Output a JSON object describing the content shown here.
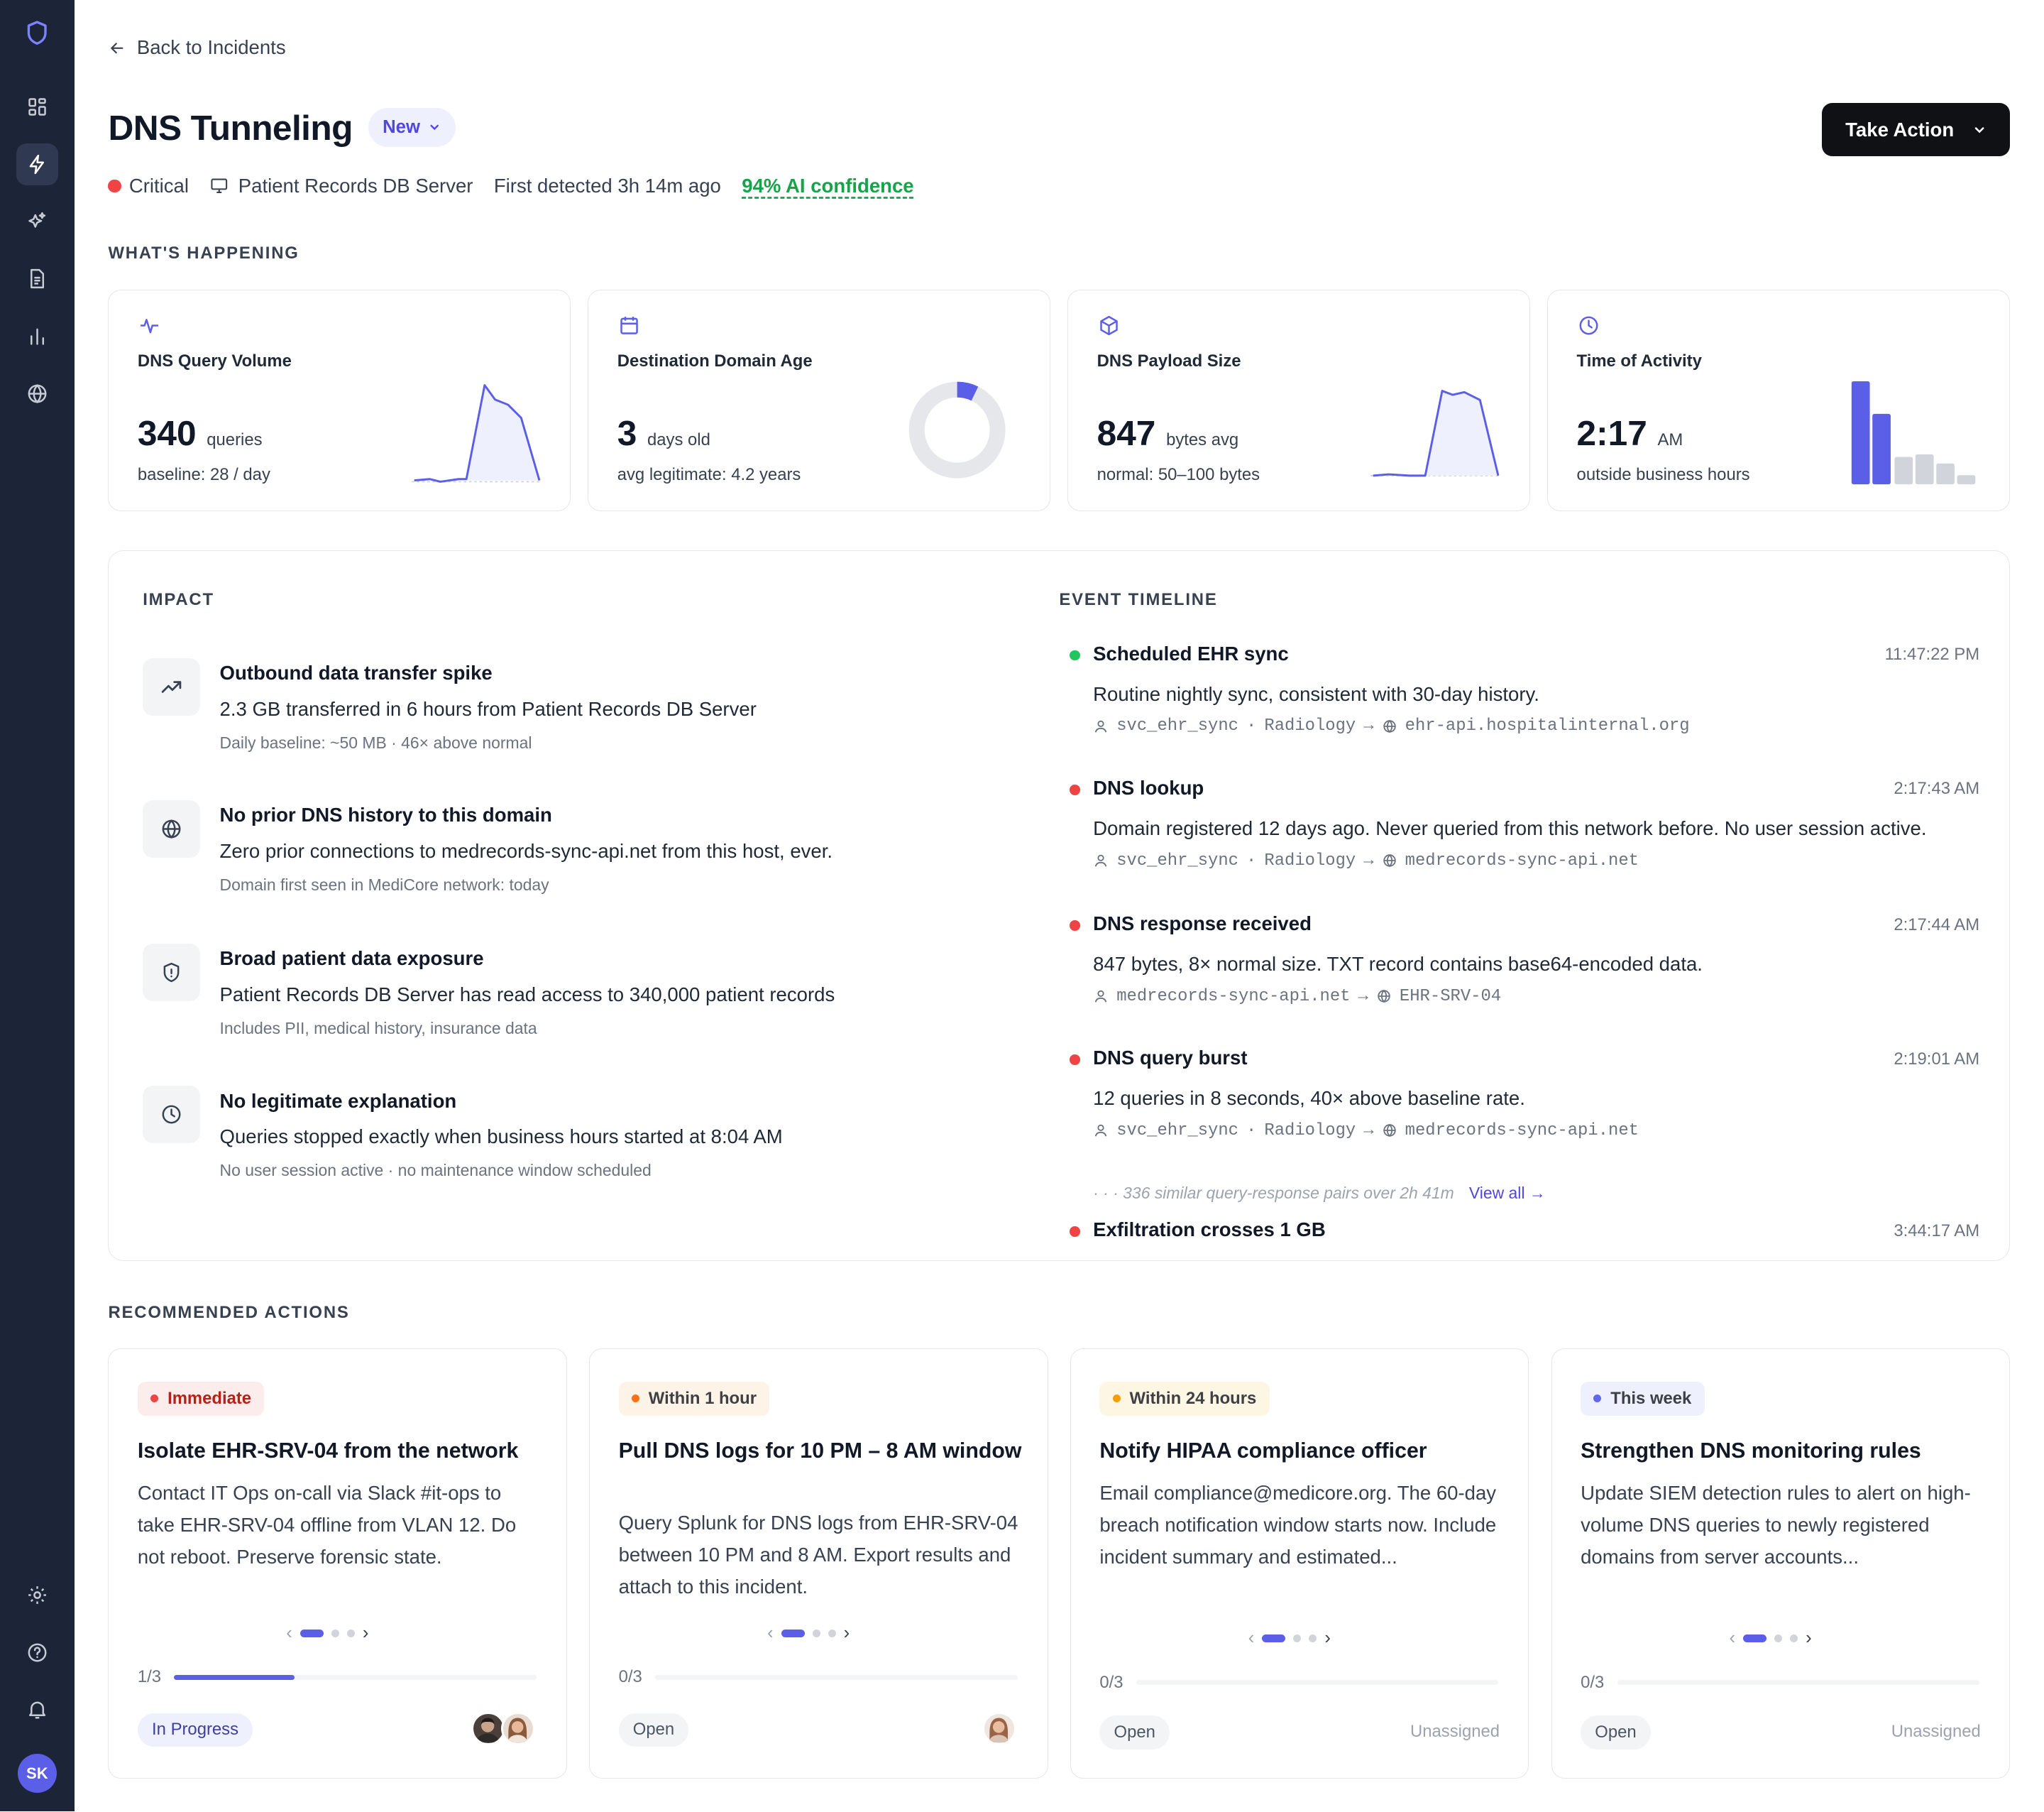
{
  "sidebar": {
    "items": [
      {
        "icon": "dashboard-icon"
      },
      {
        "icon": "lightning-icon",
        "active": true
      },
      {
        "icon": "sparkles-icon"
      },
      {
        "icon": "document-icon"
      },
      {
        "icon": "bar-chart-icon"
      },
      {
        "icon": "globe-icon"
      }
    ],
    "bottom": [
      {
        "icon": "settings-icon"
      },
      {
        "icon": "help-icon"
      },
      {
        "icon": "bell-icon"
      }
    ],
    "avatar_initials": "SK"
  },
  "header": {
    "back_label": "Back to Incidents",
    "title": "DNS Tunneling",
    "status": "New",
    "take_action_label": "Take Action",
    "severity": "Critical",
    "asset": "Patient Records DB Server",
    "first_detected": "First detected 3h 14m ago",
    "confidence": "94% AI confidence"
  },
  "whats_happening": {
    "label": "WHAT'S HAPPENING",
    "cards": [
      {
        "title": "DNS Query Volume",
        "value": "340",
        "unit": "queries",
        "sub": "baseline: 28 / day",
        "icon": "activity-icon"
      },
      {
        "title": "Destination Domain Age",
        "value": "3",
        "unit": "days old",
        "sub": "avg legitimate: 4.2 years",
        "icon": "calendar-icon"
      },
      {
        "title": "DNS Payload Size",
        "value": "847",
        "unit": "bytes avg",
        "sub": "normal: 50–100 bytes",
        "icon": "cube-icon"
      },
      {
        "title": "Time of Activity",
        "value": "2:17",
        "unit": "AM",
        "sub": "outside business hours",
        "icon": "clock-icon"
      }
    ]
  },
  "impact": {
    "label": "IMPACT",
    "items": [
      {
        "title": "Outbound data transfer spike",
        "desc": "2.3 GB transferred in 6 hours from Patient Records DB Server",
        "note": "Daily baseline: ~50 MB · 46× above normal",
        "icon": "trending-up-icon"
      },
      {
        "title": "No prior DNS history to this domain",
        "desc": "Zero prior connections to medrecords-sync-api.net from this host, ever.",
        "note": "Domain first seen in MediCore network: today",
        "icon": "globe-icon"
      },
      {
        "title": "Broad patient data exposure",
        "desc": "Patient Records DB Server has read access to 340,000 patient records",
        "note": "Includes PII, medical history, insurance data",
        "icon": "shield-alert-icon"
      },
      {
        "title": "No legitimate explanation",
        "desc": "Queries stopped exactly when business hours started at 8:04 AM",
        "note": "No user session active · no maintenance window scheduled",
        "icon": "clock-icon"
      }
    ]
  },
  "timeline": {
    "label": "EVENT TIMELINE",
    "events": [
      {
        "title": "Scheduled EHR sync",
        "time": "11:47:22 PM",
        "desc": "Routine nightly sync, consistent with 30-day history.",
        "user": "svc_ehr_sync",
        "dept": "Radiology",
        "target": "ehr-api.hospitalinternal.org",
        "color": "#22c55e"
      },
      {
        "title": "DNS lookup",
        "time": "2:17:43 AM",
        "desc": "Domain registered 12 days ago. Never queried from this network before. No user session active.",
        "user": "svc_ehr_sync",
        "dept": "Radiology",
        "target": "medrecords-sync-api.net",
        "color": "#ef4444"
      },
      {
        "title": "DNS response received",
        "time": "2:17:44 AM",
        "desc": "847 bytes, 8× normal size. TXT record contains base64-encoded data.",
        "source": "medrecords-sync-api.net",
        "target": "EHR-SRV-04",
        "color": "#ef4444"
      },
      {
        "title": "DNS query burst",
        "time": "2:19:01 AM",
        "desc": "12 queries in 8 seconds, 40× above baseline rate.",
        "user": "svc_ehr_sync",
        "dept": "Radiology",
        "target": "medrecords-sync-api.net",
        "color": "#ef4444"
      },
      {
        "title": "Exfiltration crosses 1 GB",
        "time": "3:44:17 AM",
        "color": "#ef4444"
      }
    ],
    "more_text": "· · · 336 similar query-response pairs over 2h 41m",
    "view_all": "View all →"
  },
  "recommended": {
    "label": "RECOMMENDED ACTIONS",
    "actions": [
      {
        "badge": "Immediate",
        "badge_color": "#ef4444",
        "badge_bg": "#fdecec",
        "badge_fg": "#b42318",
        "title": "Isolate EHR-SRV-04 from the network",
        "desc": "Contact IT Ops on-call via Slack #it-ops to take EHR-SRV-04 offline from VLAN 12. Do not reboot. Preserve forensic state.",
        "progress_label": "1/3",
        "progress": 0.333,
        "status": "In Progress",
        "assignee": ""
      },
      {
        "badge": "Within 1 hour",
        "badge_color": "#f97316",
        "badge_bg": "#fdf3e7",
        "badge_fg": "#3f3f46",
        "title": "Pull DNS logs for 10 PM – 8 AM window",
        "desc": "Query Splunk for DNS logs from EHR-SRV-04 between 10 PM and 8 AM. Export results and attach to this incident.",
        "progress_label": "0/3",
        "progress": 0,
        "status": "Open",
        "assignee": ""
      },
      {
        "badge": "Within 24 hours",
        "badge_color": "#f59e0b",
        "badge_bg": "#fdf6e3",
        "badge_fg": "#3f3f46",
        "title": "Notify HIPAA compliance officer",
        "desc": "Email compliance@medicore.org. The 60-day breach notification window starts now. Include incident summary and estimated...",
        "progress_label": "0/3",
        "progress": 0,
        "status": "Open",
        "assignee": "Unassigned"
      },
      {
        "badge": "This week",
        "badge_color": "#6366f1",
        "badge_bg": "#eef0fd",
        "badge_fg": "#3f3f46",
        "title": "Strengthen DNS monitoring rules",
        "desc": "Update SIEM detection rules to alert on high-volume DNS queries to newly registered domains from server accounts...",
        "progress_label": "0/3",
        "progress": 0,
        "status": "Open",
        "assignee": "Unassigned"
      }
    ]
  },
  "colors": {
    "accent": "#5b5ee6",
    "critical": "#ef4444",
    "success": "#16a34a",
    "sidebar": "#1c2437"
  }
}
